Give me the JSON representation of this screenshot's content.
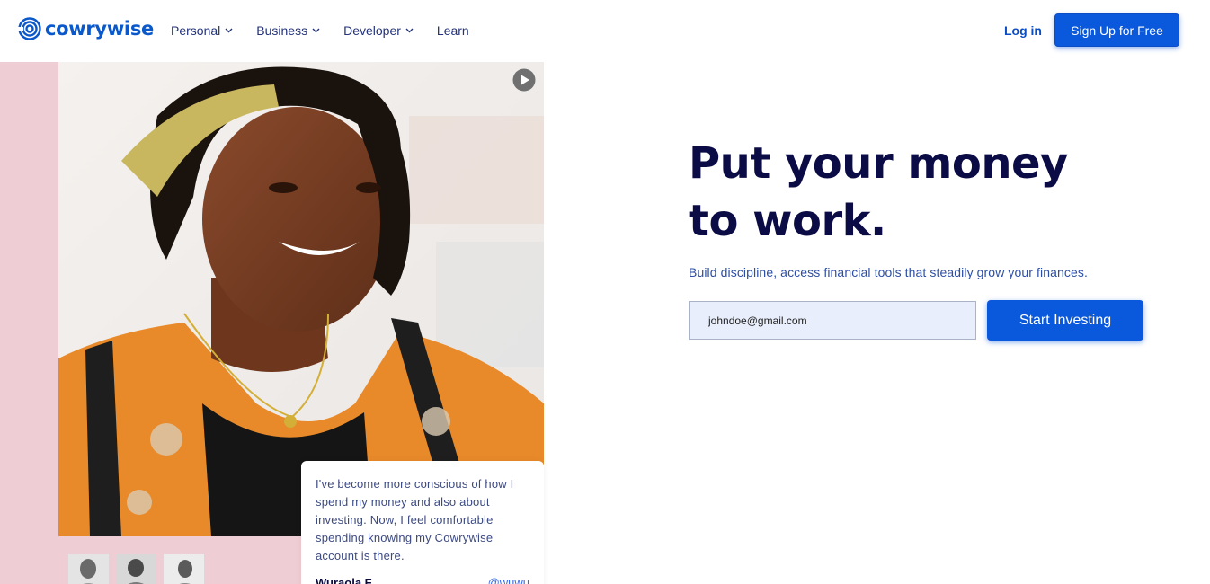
{
  "brand": {
    "name": "cowrywise",
    "accent": "#0a58dc"
  },
  "nav": {
    "items": [
      {
        "label": "Personal",
        "has_dropdown": true
      },
      {
        "label": "Business",
        "has_dropdown": true
      },
      {
        "label": "Developer",
        "has_dropdown": true
      },
      {
        "label": "Learn",
        "has_dropdown": false
      }
    ],
    "login_label": "Log in",
    "signup_label": "Sign Up for Free"
  },
  "hero": {
    "headline_line1": "Put your money",
    "headline_line2": "to work.",
    "subline": "Build discipline, access financial tools that steadily grow your finances.",
    "email_value": "johndoe@gmail.com",
    "cta_label": "Start Investing"
  },
  "testimonial": {
    "quote": "I've become more conscious of how I spend my money and also about investing. Now, I feel comfortable spending knowing my Cowrywise account is there.",
    "author": "Wuraola F.",
    "handle": "@wuwu"
  },
  "icons": {
    "play": "play-icon",
    "logo": "cowrywise-logo-icon",
    "chevron": "chevron-down-icon"
  }
}
